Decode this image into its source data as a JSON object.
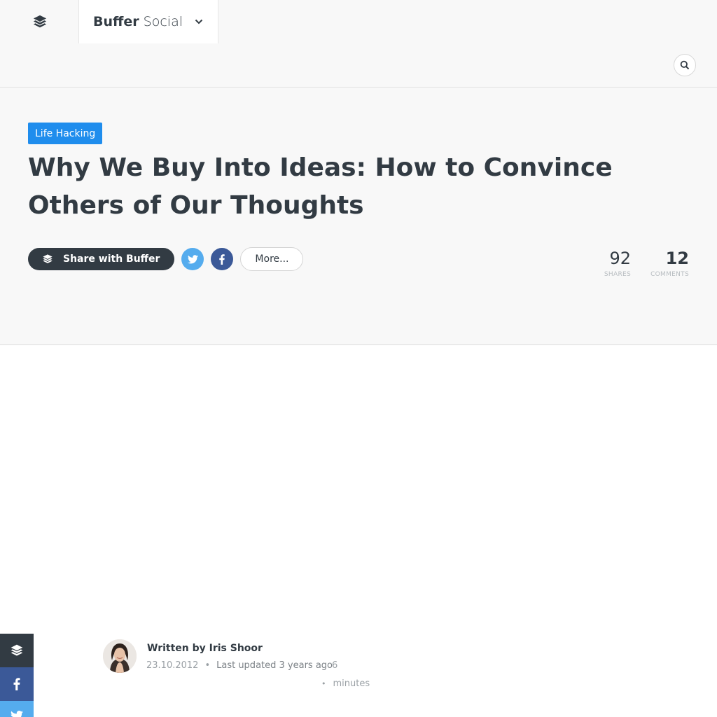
{
  "header": {
    "brand_bold": "Buffer",
    "brand_light": "Social",
    "search_icon": "search-icon",
    "dropdown_icon": "chevron-down-icon"
  },
  "article": {
    "category": "Life Hacking",
    "title": "Why We Buy Into Ideas: How to Convince Others of Our Thoughts"
  },
  "share": {
    "buffer_label": "Share with Buffer",
    "more_label": "More...",
    "shares_count": "92",
    "shares_label": "SHARES",
    "comments_count": "12",
    "comments_label": "COMMENTS"
  },
  "author": {
    "written_by": "Written by Iris Shoor",
    "date": "23.10.2012",
    "separator": "•",
    "updated": "Last updated 3 years ago",
    "read_time_num": "6",
    "read_time_unit": "minutes"
  },
  "colors": {
    "accent": "#1f8ded",
    "dark": "#323b43",
    "twitter": "#55acee",
    "facebook": "#3b5998"
  }
}
